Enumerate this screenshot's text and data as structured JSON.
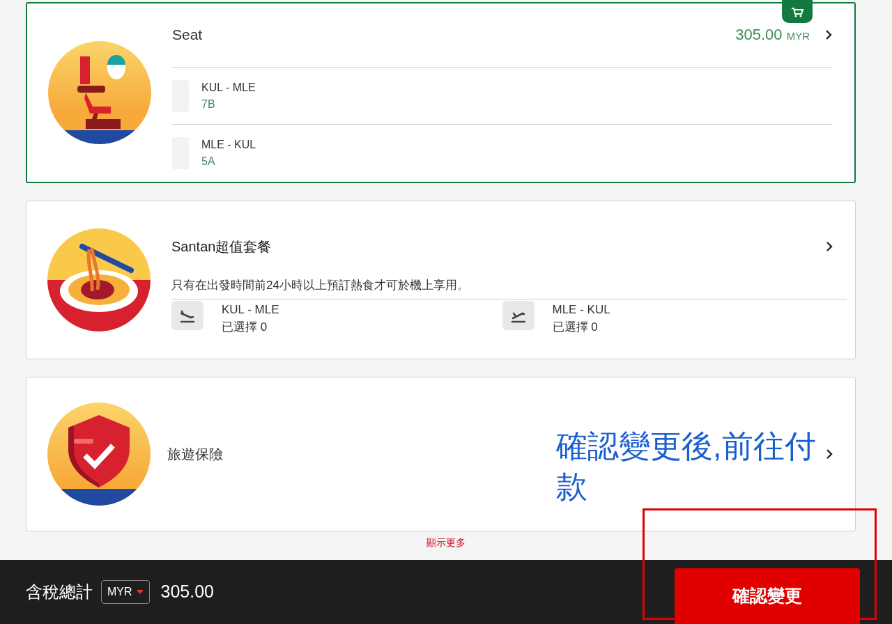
{
  "cards": [
    {
      "kind": "seat",
      "title": "Seat",
      "selected": true,
      "price": "305.00",
      "currency": "MYR",
      "segments": [
        {
          "route": "KUL - MLE",
          "value": "7B"
        },
        {
          "route": "MLE - KUL",
          "value": "5A"
        }
      ]
    },
    {
      "kind": "meal",
      "title": "Santan超值套餐",
      "selected": false,
      "note": "只有在出發時間前24小時以上預訂熱食才可於機上享用。",
      "segments": [
        {
          "route": "KUL - MLE",
          "value": "已選擇 0",
          "kind": "landing"
        },
        {
          "route": "MLE - KUL",
          "value": "已選擇 0",
          "kind": "takeoff"
        }
      ]
    },
    {
      "kind": "insurance",
      "title": "旅遊保險",
      "selected": false
    }
  ],
  "show_more": "顯示更多",
  "footer": {
    "total_label": "含稅總計",
    "currency": "MYR",
    "total": "305.00",
    "confirm_button": "確認變更"
  },
  "annotation": {
    "text": "確認變更後,前往付款"
  }
}
